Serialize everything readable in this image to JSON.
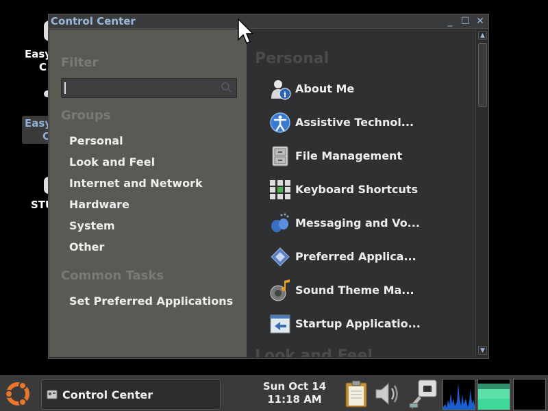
{
  "desktop": {
    "icon1_label_line1": "Easy",
    "icon1_label_line2": "C",
    "icon2_label_line1": "Easy",
    "icon2_label_line2": "C",
    "icon3_label": "STU"
  },
  "window": {
    "title": "Control Center",
    "minimize_glyph": "_",
    "maximize_glyph": "☐",
    "close_glyph": "✕"
  },
  "left_pane": {
    "filter_heading": "Filter",
    "search_value": "",
    "groups_heading": "Groups",
    "groups": [
      "Personal",
      "Look and Feel",
      "Internet and Network",
      "Hardware",
      "System",
      "Other"
    ],
    "common_tasks_heading": "Common Tasks",
    "tasks": [
      "Set Preferred Applications"
    ]
  },
  "right_pane": {
    "category_personal": "Personal",
    "category_look": "Look and Feel",
    "items": [
      {
        "label": "About Me",
        "icon": "user-info-icon"
      },
      {
        "label": "Assistive Technol...",
        "icon": "accessibility-icon"
      },
      {
        "label": "File Management",
        "icon": "file-cabinet-icon"
      },
      {
        "label": "Keyboard Shortcuts",
        "icon": "keyboard-icon"
      },
      {
        "label": "Messaging and Vo...",
        "icon": "messaging-icon"
      },
      {
        "label": "Preferred Applica...",
        "icon": "preferred-apps-icon"
      },
      {
        "label": "Sound Theme Ma...",
        "icon": "sound-theme-icon"
      },
      {
        "label": "Startup Applicatio...",
        "icon": "startup-icon"
      }
    ]
  },
  "taskbar": {
    "task_label": "Control Center",
    "date": "Sun Oct 14",
    "time": "11:18 AM"
  },
  "colors": {
    "title_accent": "#9bb8d8",
    "left_pane_bg": "#5a5a55",
    "right_pane_bg": "#2e3032",
    "cpu_graph": "#1a5fd0",
    "mem_graph": "#3ed99a"
  }
}
